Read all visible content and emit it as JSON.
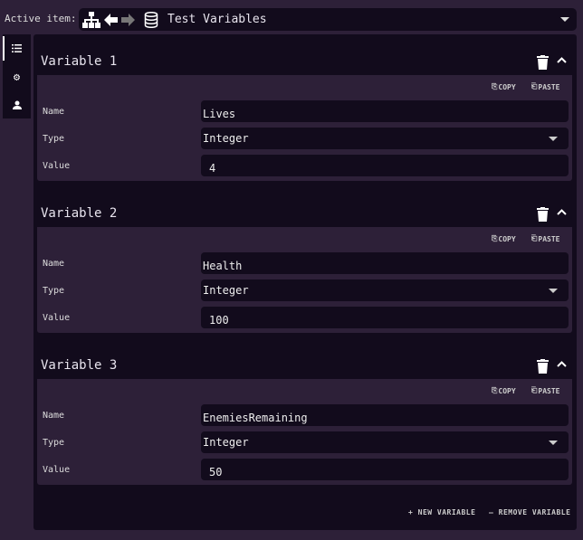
{
  "header": {
    "active_label": "Active item:",
    "title": "Test Variables"
  },
  "sidebar": {
    "items": [
      {
        "icon": "list-icon"
      },
      {
        "icon": "gear-icon"
      },
      {
        "icon": "user-icon"
      }
    ]
  },
  "labels": {
    "name": "Name",
    "type": "Type",
    "value": "Value",
    "copy": "COPY",
    "paste": "PASTE"
  },
  "variables": [
    {
      "title": "Variable 1",
      "name": "Lives",
      "type": "Integer",
      "value": "4"
    },
    {
      "title": "Variable 2",
      "name": "Health",
      "type": "Integer",
      "value": "100"
    },
    {
      "title": "Variable 3",
      "name": "EnemiesRemaining",
      "type": "Integer",
      "value": "50"
    }
  ],
  "footer": {
    "new": "NEW VARIABLE",
    "remove": "REMOVE VARIABLE"
  },
  "colors": {
    "bg": "#2d2038",
    "panel": "#120b1c"
  }
}
